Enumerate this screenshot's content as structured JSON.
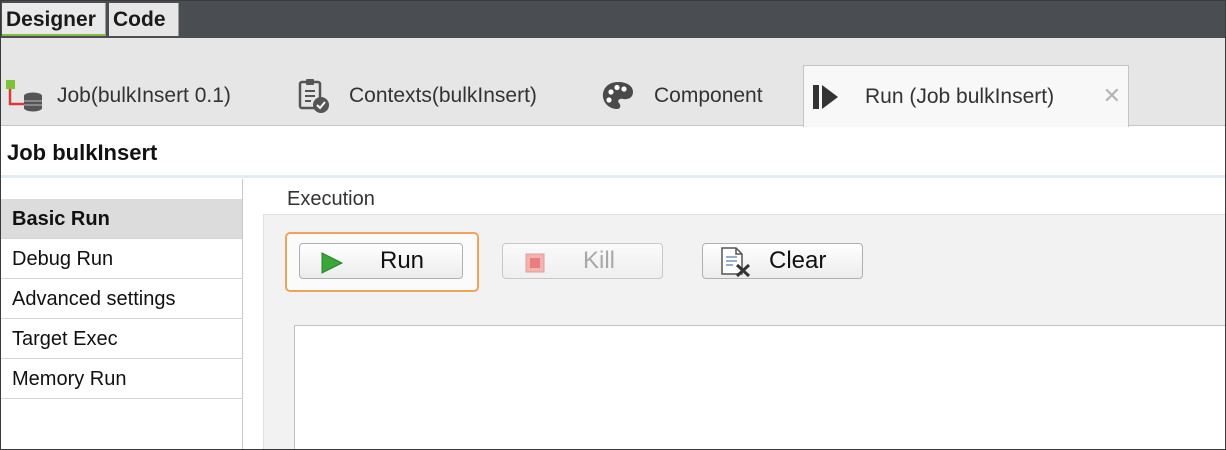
{
  "editor_tabs": [
    {
      "label": "Designer"
    },
    {
      "label": "Code"
    }
  ],
  "view_tabs": [
    {
      "label": "Job(bulkInsert 0.1)",
      "icon": "job-icon"
    },
    {
      "label": "Contexts(bulkInsert)",
      "icon": "contexts-icon"
    },
    {
      "label": "Component",
      "icon": "palette-icon"
    },
    {
      "label": "Run (Job bulkInsert)",
      "icon": "run-view-icon"
    }
  ],
  "close_glyph": "✕",
  "job_title": "Job bulkInsert",
  "sidebar": {
    "items": [
      {
        "label": "Basic Run"
      },
      {
        "label": "Debug Run"
      },
      {
        "label": "Advanced settings"
      },
      {
        "label": "Target Exec"
      },
      {
        "label": "Memory Run"
      }
    ],
    "active": "Basic Run"
  },
  "execution": {
    "title": "Execution",
    "run_label": "Run",
    "kill_label": "Kill",
    "clear_label": "Clear",
    "console_text": ""
  },
  "colors": {
    "accent_focus": "#f0a35a",
    "designer_underline": "#7fbf3f",
    "run_green": "#3aa63a",
    "kill_red": "#e87f7f"
  }
}
